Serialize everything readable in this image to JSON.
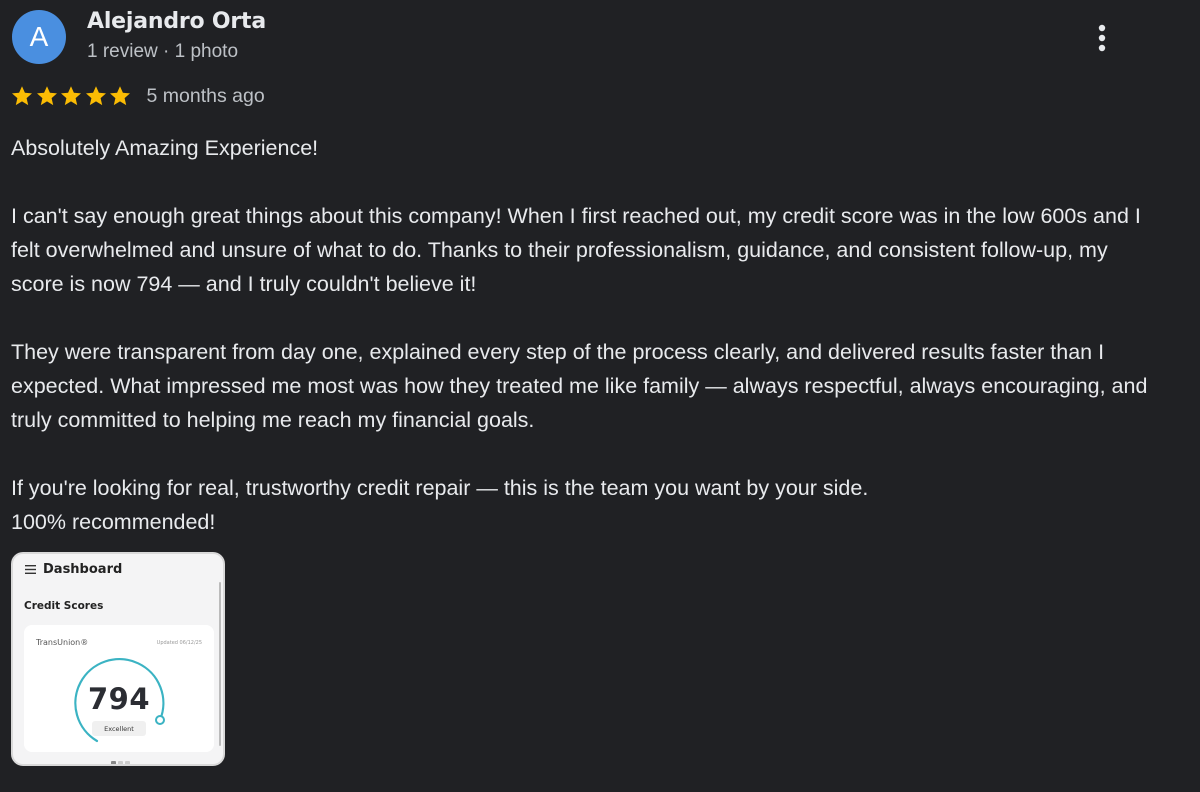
{
  "author": {
    "initial": "A",
    "name": "Alejandro Orta",
    "meta": "1 review · 1 photo",
    "avatar_color": "#4a8fe0"
  },
  "rating": {
    "stars": 5,
    "max": 5,
    "time": "5 months ago",
    "star_color": "#fbbc04"
  },
  "review": {
    "paragraphs": [
      "Absolutely Amazing Experience!",
      "I can't say enough great things about this company! When I first reached out, my credit score was in the low 600s and I felt overwhelmed and unsure of what to do. Thanks to their professionalism, guidance, and consistent follow-up, my score is now 794 — and I truly couldn't believe it!",
      "They were transparent from day one, explained every step of the process clearly, and delivered results faster than I expected. What impressed me most was how they treated me like family — always respectful, always encouraging, and truly committed to helping me reach my financial goals.",
      "If you're looking for real, trustworthy credit repair — this is the team you want by your side.\n100% recommended!"
    ]
  },
  "photo": {
    "header": "Dashboard",
    "section": "Credit Scores",
    "bureau": "TransUnion®",
    "updated": "Updated 06/12/25",
    "score": "794",
    "score_label": "Excellent",
    "gauge_color": "#3bb3c3"
  },
  "icons": {
    "more": "more-vert-icon",
    "star": "star-icon",
    "menu": "menu-icon"
  }
}
